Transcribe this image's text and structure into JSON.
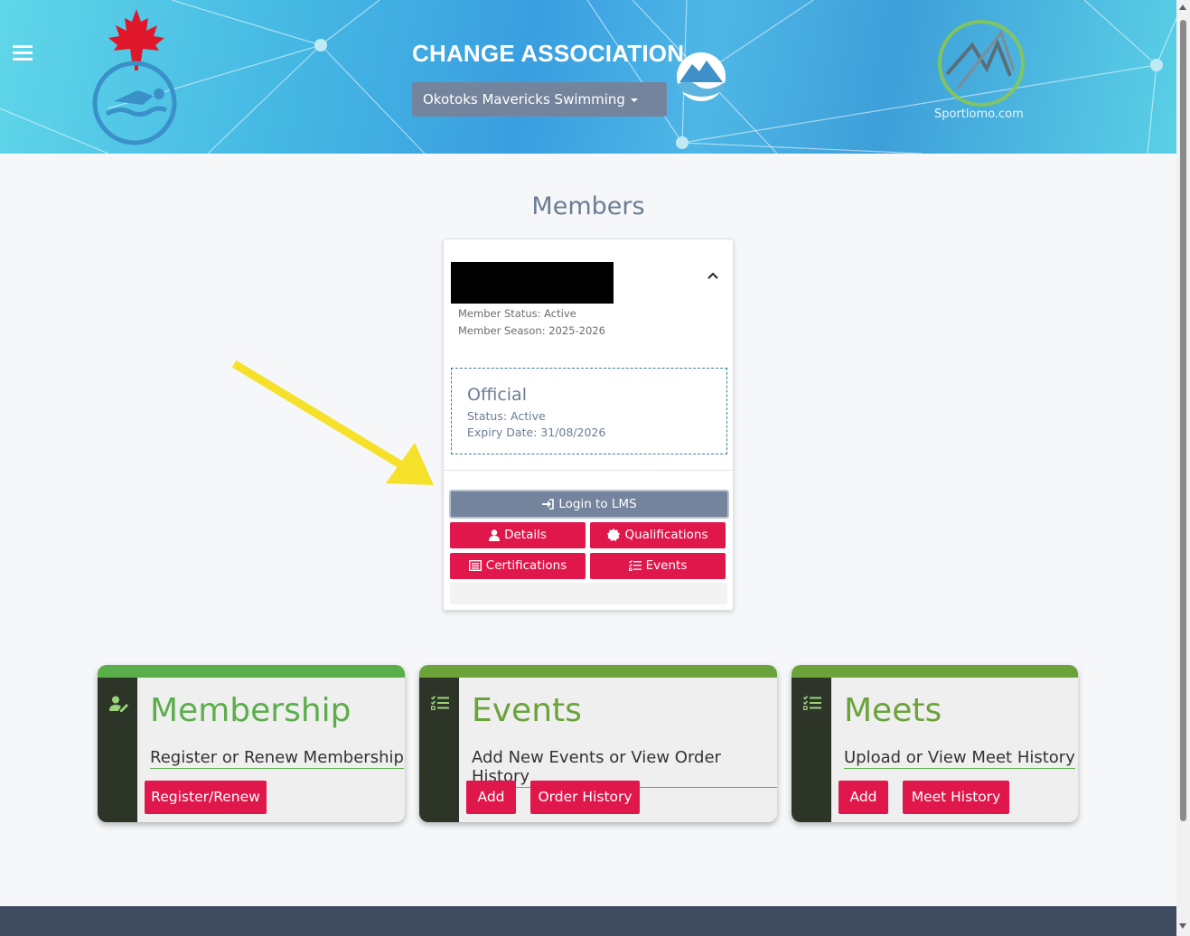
{
  "header": {
    "title": "CHANGE ASSOCIATION",
    "association_selected": "Okotoks Mavericks Swimming",
    "sportlomo_text": "Sportlomo.com"
  },
  "members": {
    "title": "Members",
    "member_status": "Member Status: Active",
    "member_season": "Member Season: 2025-2026",
    "official": {
      "heading": "Official",
      "status": "Status: Active",
      "expiry": "Expiry Date: 31/08/2026"
    },
    "buttons": {
      "login_lms": "Login to LMS",
      "details": "Details",
      "qualifications": "Qualifications",
      "certifications": "Certifications",
      "events": "Events"
    }
  },
  "tiles": [
    {
      "title": "Membership",
      "link": "Register or Renew Membership",
      "buttons": [
        "Register/Renew"
      ]
    },
    {
      "title": "Events",
      "link": "Add New Events or View Order History",
      "buttons": [
        "Add",
        "Order History"
      ]
    },
    {
      "title": "Meets",
      "link": "Upload or View Meet History",
      "buttons": [
        "Add",
        "Meet History"
      ]
    }
  ],
  "colors": {
    "accent_red": "#e0174b",
    "slate_button": "#74849c",
    "tile_green": "#5bae4a",
    "tile_dark": "#2d3428",
    "footer": "#3e4a5e"
  },
  "icons": [
    "hamburger-menu-icon",
    "swimming-canada-logo",
    "mountain-logo",
    "sportlomo-logo",
    "chevron-up-icon",
    "sign-in-icon",
    "user-icon",
    "badge-icon",
    "list-alt-icon",
    "tasks-icon",
    "user-edit-icon"
  ]
}
